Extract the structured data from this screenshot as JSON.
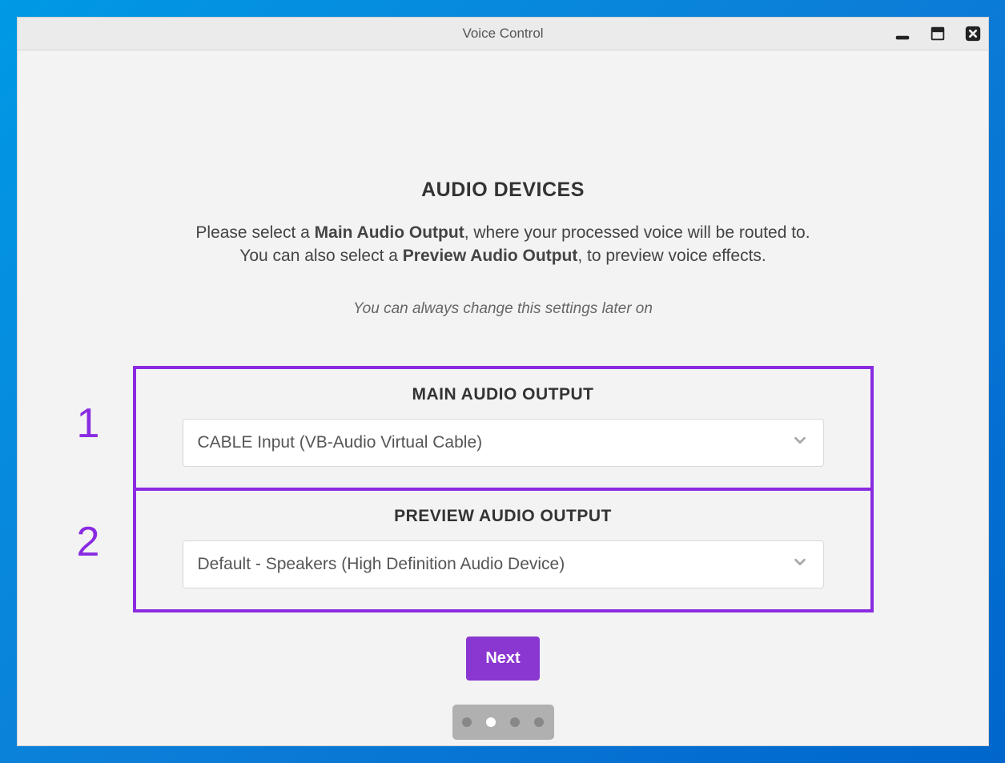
{
  "window": {
    "title": "Voice Control"
  },
  "page": {
    "heading": "AUDIO DEVICES",
    "desc_prefix": "Please select a ",
    "desc_bold1": "Main Audio Output",
    "desc_mid1": ", where your processed voice will be routed to.",
    "desc_line2_prefix": "You can also select a ",
    "desc_bold2": "Preview Audio Output",
    "desc_line2_suffix": ", to preview voice effects.",
    "hint": "You can always change this settings later on"
  },
  "annotations": {
    "num1": "1",
    "num2": "2"
  },
  "settings": {
    "main": {
      "label": "MAIN AUDIO OUTPUT",
      "value": "CABLE Input (VB-Audio Virtual Cable)"
    },
    "preview": {
      "label": "PREVIEW AUDIO OUTPUT",
      "value": "Default - Speakers (High Definition Audio Device)"
    }
  },
  "buttons": {
    "next": "Next"
  },
  "pager": {
    "total": 4,
    "active_index": 1
  }
}
